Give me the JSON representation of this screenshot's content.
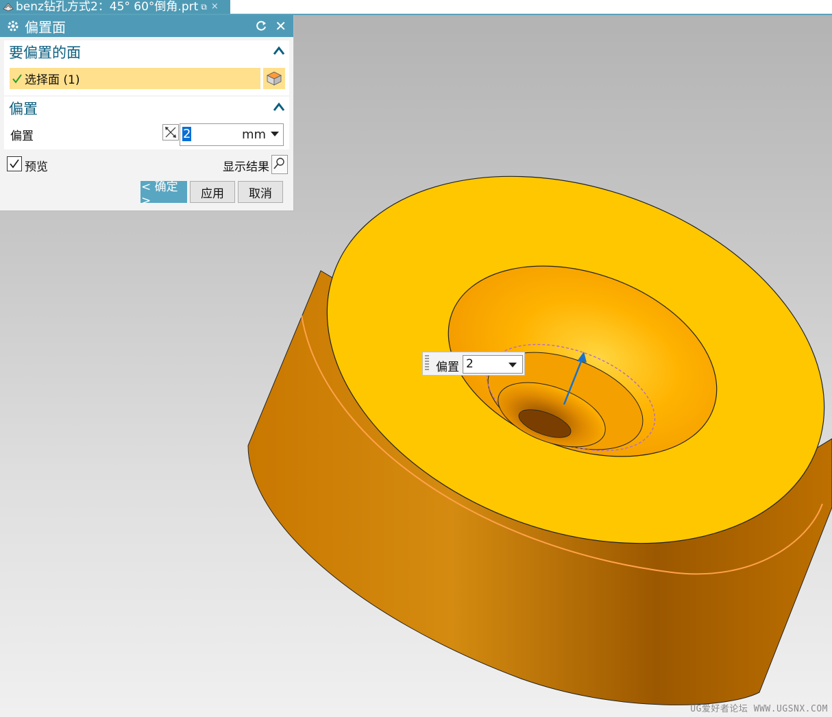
{
  "document_tab": {
    "title": "benz钻孔方式2：45° 60°倒角.prt",
    "pin_glyph": "⧉",
    "close_glyph": "×"
  },
  "dialog": {
    "title": "偏置面",
    "close_glyph": "✕",
    "face_group": {
      "header": "要偏置的面",
      "selection_label": "选择面 (1)"
    },
    "offset_group": {
      "header": "偏置",
      "label": "偏置",
      "value": "2",
      "unit": "mm"
    },
    "preview_label": "预览",
    "preview_checked": true,
    "show_result_label": "显示结果",
    "ok_label": "< 确定 >",
    "apply_label": "应用",
    "cancel_label": "取消"
  },
  "onscreen_input": {
    "label": "偏置",
    "value": "2"
  },
  "watermark": "UG爱好者论坛 WWW.UGSNX.COM",
  "colors": {
    "title_bar": "#4f9bb7",
    "selected_row": "#ffe08c",
    "part_top": "#ffc800",
    "part_side": "#c97a00",
    "offset_arrow": "#1a72c8"
  }
}
